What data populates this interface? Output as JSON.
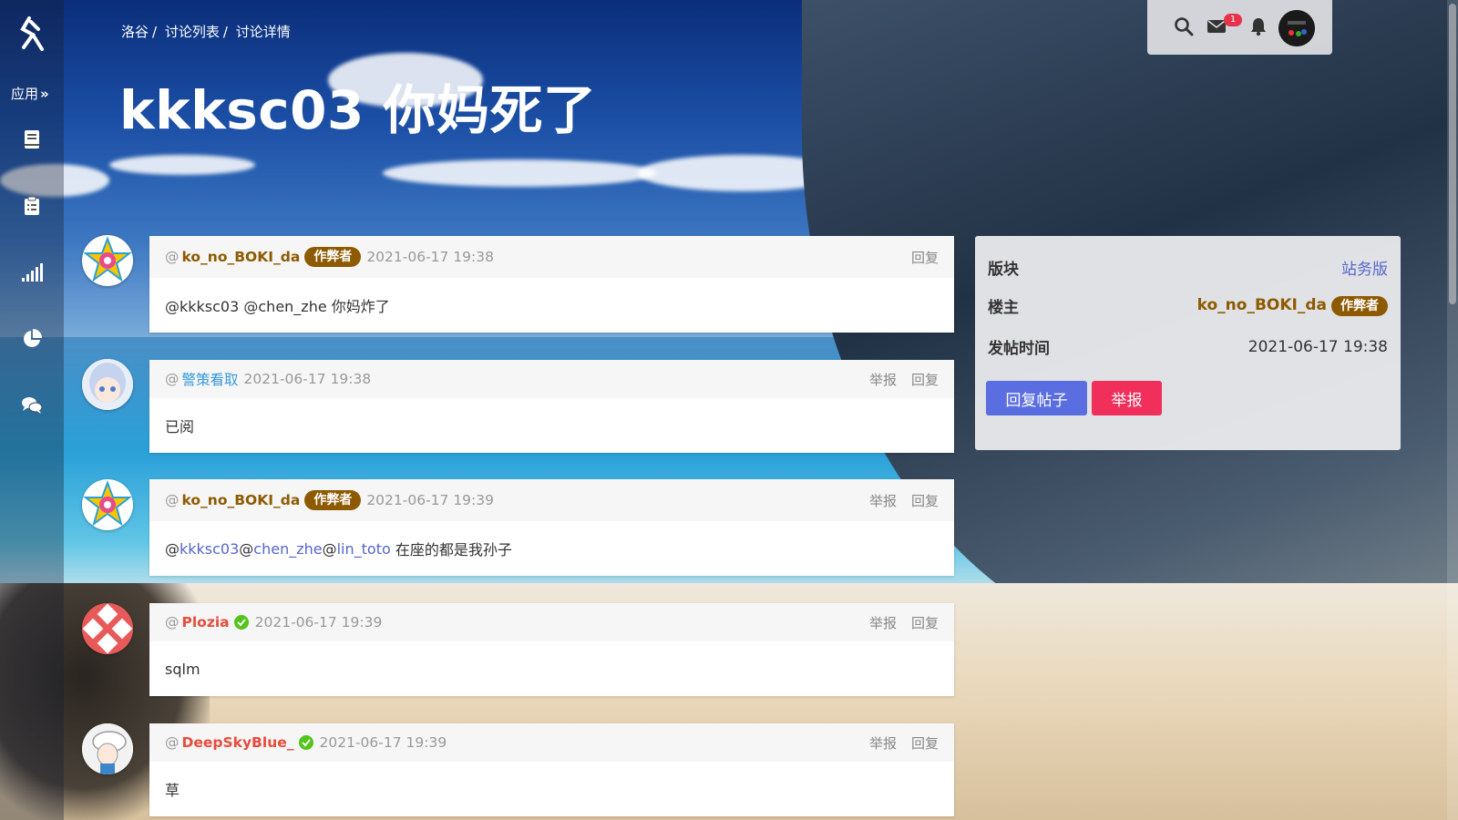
{
  "breadcrumb": {
    "items": [
      "洛谷",
      "讨论列表",
      "讨论详情"
    ],
    "sep": "/"
  },
  "title": "kkksc03 你妈死了",
  "sidebar": {
    "apps_label": "应用",
    "apps_chevron": "»"
  },
  "topbar": {
    "message_count": "1"
  },
  "posts": [
    {
      "at": "@",
      "user": "ko_no_BOKI_da",
      "user_color": "#8e5a00",
      "badge": "作弊者",
      "time": "2021-06-17 19:38",
      "actions": [
        "回复"
      ],
      "body": [
        "@kkksc03 @chen_zhe 你妈炸了"
      ]
    },
    {
      "at": "@",
      "user": "警策看取",
      "user_color": "#3498db",
      "time": "2021-06-17 19:38",
      "actions": [
        "举报",
        "回复"
      ],
      "body": [
        "已阅"
      ]
    },
    {
      "at": "@",
      "user": "ko_no_BOKI_da",
      "user_color": "#8e5a00",
      "badge": "作弊者",
      "time": "2021-06-17 19:39",
      "actions": [
        "举报",
        "回复"
      ],
      "body": [
        "@",
        "kkksc03",
        " @",
        "chen_zhe",
        " @",
        "lin_toto",
        " 在座的都是我孙子"
      ]
    },
    {
      "at": "@",
      "user": "Plozia",
      "user_color": "#e74c3c",
      "verified": true,
      "time": "2021-06-17 19:39",
      "actions": [
        "举报",
        "回复"
      ],
      "body": [
        "sqlm"
      ]
    },
    {
      "at": "@",
      "user": "DeepSkyBlue_",
      "user_color": "#e74c3c",
      "verified": true,
      "time": "2021-06-17 19:39",
      "actions": [
        "举报",
        "回复"
      ],
      "body": [
        "草"
      ]
    }
  ],
  "panel": {
    "section_label": "版块",
    "section_value": "站务版",
    "owner_label": "楼主",
    "owner_value": "ko_no_BOKI_da",
    "owner_badge": "作弊者",
    "time_label": "发帖时间",
    "time_value": "2021-06-17 19:38",
    "reply_button": "回复帖子",
    "report_button": "举报"
  },
  "colors": {
    "author_badge": "#8e5a00",
    "link": "#5566cc",
    "reply_button": "#5b6ee1",
    "report_button": "#f0305a",
    "verified": "#52c41a",
    "red_name": "#e74c3c",
    "blue_name": "#3498db"
  },
  "icons": [
    "logo-icon",
    "book-icon",
    "clipboard-icon",
    "signal-bars-icon",
    "pie-chart-icon",
    "chat-icon",
    "search-icon",
    "mail-icon",
    "bell-icon",
    "verified-icon"
  ]
}
